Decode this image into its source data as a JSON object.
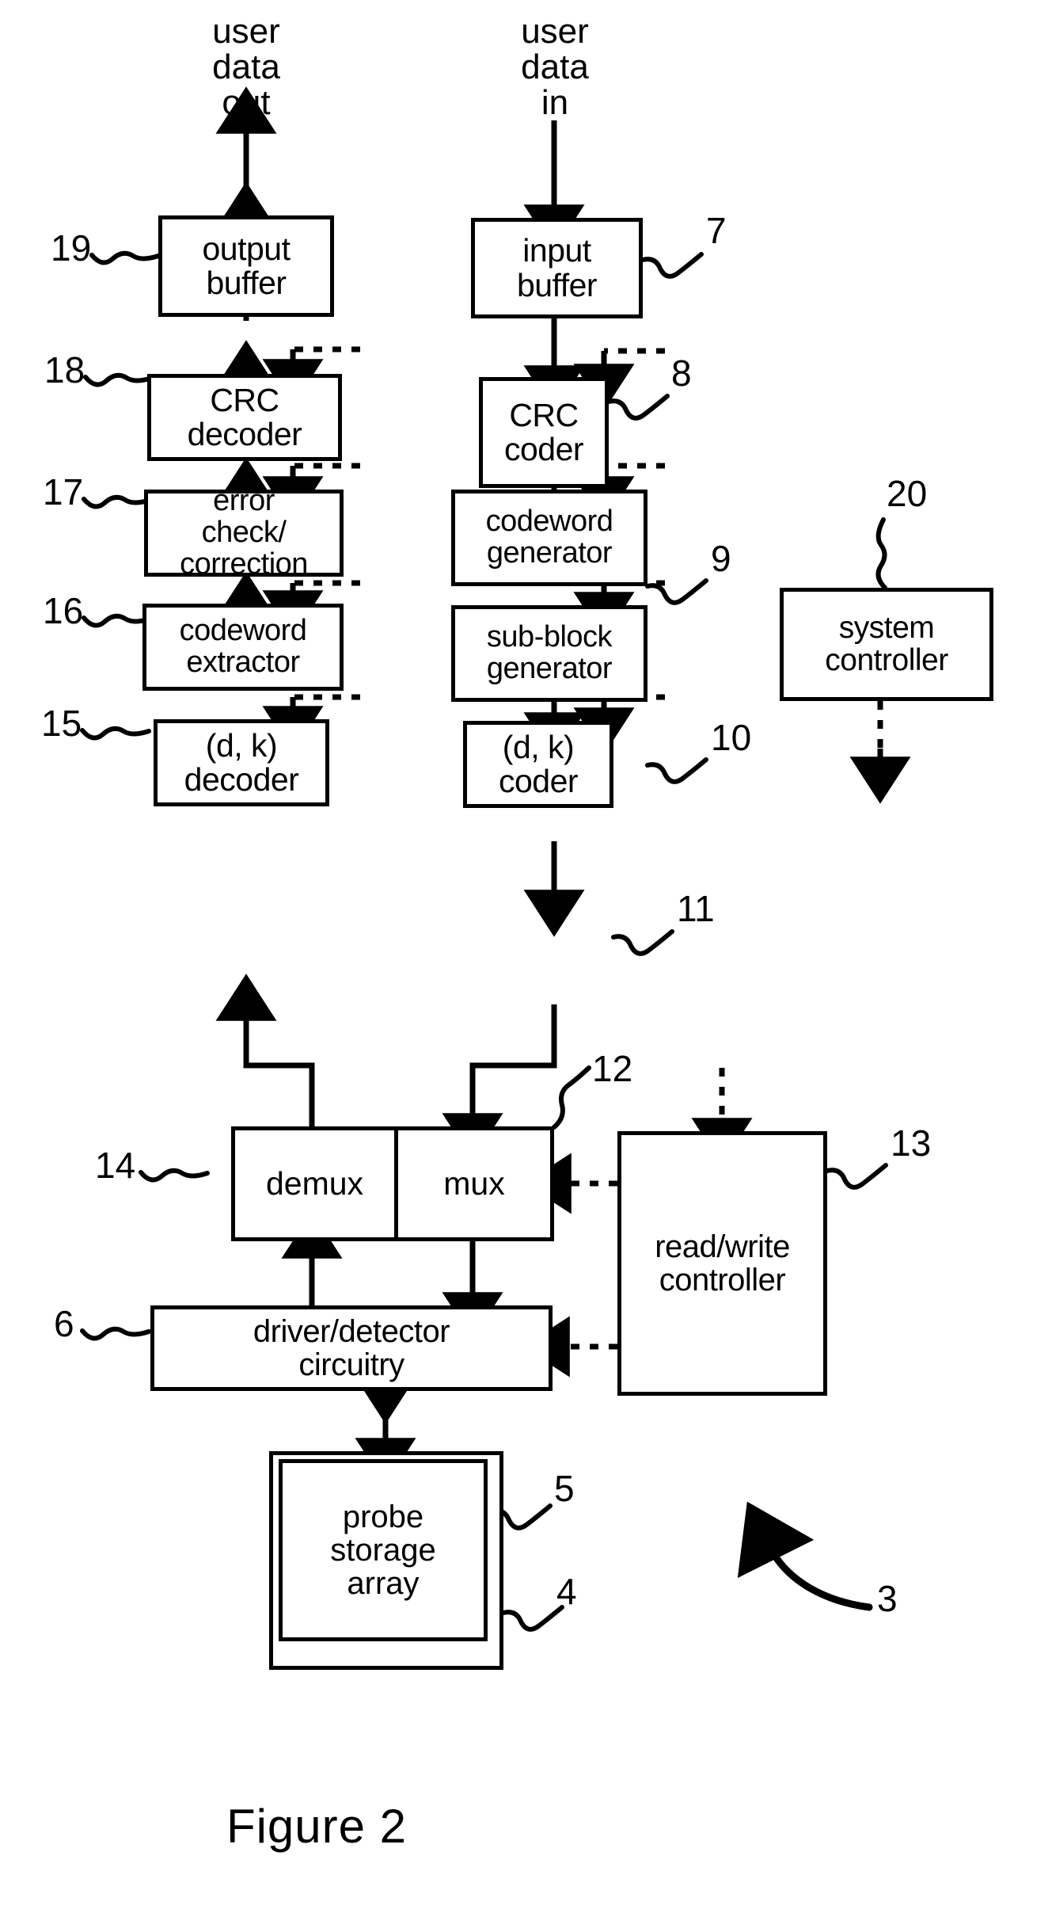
{
  "figure": {
    "caption": "Figure 2",
    "io_labels": {
      "user_data_out": "user\ndata\nout",
      "user_data_in": "user\ndata\nin"
    },
    "blocks": [
      {
        "id": "output-buffer",
        "label": "output\nbuffer",
        "ref": "19"
      },
      {
        "id": "crc-decoder",
        "label": "CRC\ndecoder",
        "ref": "18"
      },
      {
        "id": "error-check",
        "label": "error\ncheck/\ncorrection",
        "ref": "17"
      },
      {
        "id": "codeword-extractor",
        "label": "codeword\nextractor",
        "ref": "16"
      },
      {
        "id": "dk-decoder",
        "label": "(d, k)\ndecoder",
        "ref": "15"
      },
      {
        "id": "input-buffer",
        "label": "input\nbuffer",
        "ref": "7"
      },
      {
        "id": "crc-coder",
        "label": "CRC\ncoder",
        "ref": "8"
      },
      {
        "id": "codeword-generator",
        "label": "codeword\ngenerator",
        "ref": "9"
      },
      {
        "id": "subblock-generator",
        "label": "sub-block\ngenerator",
        "ref": "10"
      },
      {
        "id": "dk-coder",
        "label": "(d, k)\ncoder",
        "ref": "11"
      },
      {
        "id": "demux",
        "label": "demux",
        "ref": "14"
      },
      {
        "id": "mux",
        "label": "mux",
        "ref": "12"
      },
      {
        "id": "driver-detector",
        "label": "driver/detector\ncircuitry",
        "ref": "6"
      },
      {
        "id": "read-write-controller",
        "label": "read/write\ncontroller",
        "ref": "13"
      },
      {
        "id": "system-controller",
        "label": "system\ncontroller",
        "ref": "20"
      },
      {
        "id": "probe-storage-array",
        "label": "probe\nstorage\narray",
        "ref": "5"
      },
      {
        "id": "storage-device-outer",
        "label": "",
        "ref": "4"
      },
      {
        "id": "apparatus",
        "label": "",
        "ref": "3"
      }
    ],
    "ref_numbers": {
      "r19": "19",
      "r18": "18",
      "r17": "17",
      "r16": "16",
      "r15": "15",
      "r14": "14",
      "r6": "6",
      "r5": "5",
      "r4": "4",
      "r3": "3",
      "r7": "7",
      "r8": "8",
      "r9": "9",
      "r10": "10",
      "r11": "11",
      "r12": "12",
      "r13": "13",
      "r20": "20"
    },
    "block_labels": {
      "output_buffer": "output\nbuffer",
      "crc_decoder": "CRC\ndecoder",
      "error_check": "error\ncheck/\ncorrection",
      "codeword_extractor": "codeword\nextractor",
      "dk_decoder": "(d, k)\ndecoder",
      "input_buffer": "input\nbuffer",
      "crc_coder": "CRC\ncoder",
      "codeword_generator": "codeword\ngenerator",
      "subblock_generator": "sub-block\ngenerator",
      "dk_coder": "(d, k)\ncoder",
      "demux": "demux",
      "mux": "mux",
      "driver_detector": "driver/detector\ncircuitry",
      "read_write_controller": "read/write\ncontroller",
      "system_controller": "system\ncontroller",
      "probe_storage_array": "probe\nstorage\narray"
    },
    "colors": {
      "stroke": "#000000",
      "background": "#ffffff"
    }
  }
}
